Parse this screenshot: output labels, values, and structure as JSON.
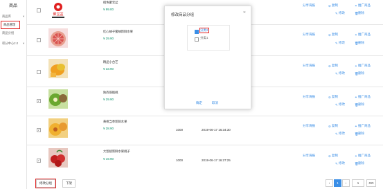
{
  "sidebar": {
    "title": "商品",
    "items": [
      {
        "label": "商品库",
        "chev": "▾"
      },
      {
        "label": "商品管理",
        "chev": ""
      },
      {
        "label": "商品分组",
        "chev": ""
      },
      {
        "label": "积分中心2.0",
        "chev": "▾"
      }
    ]
  },
  "products": [
    {
      "name": "聚宝盆",
      "subname": "橙色聚宝盆",
      "price": "¥ 99.00",
      "stock": "",
      "time": "",
      "checked": false,
      "thumb": "logo"
    },
    {
      "name": "红心柚子蜜柚新鲜水果",
      "price": "¥ 29.90",
      "stock": "",
      "time": "",
      "checked": false,
      "thumb": "grapefruit"
    },
    {
      "name": "精品小台芒",
      "price": "¥ 33.90",
      "stock": "",
      "time": "",
      "checked": false,
      "thumb": "mango"
    },
    {
      "name": "陕西猕猴桃",
      "price": "¥ 29.90",
      "stock": "",
      "time": "",
      "checked": true,
      "thumb": "kiwi"
    },
    {
      "name": "黄桃当季新鲜水果",
      "price": "¥ 28.90",
      "stock": "1000",
      "time": "2019-06-17 16:34:30",
      "checked": true,
      "thumb": "peach"
    },
    {
      "name": "大梨桃新鲜水果桃子",
      "price": "¥ 19.90",
      "stock": "1000",
      "time": "2019-06-17 16:27:25",
      "checked": true,
      "thumb": "cherry"
    }
  ],
  "actions": {
    "share": "分享海报",
    "copy": "复制",
    "promote": "推广商品",
    "edit": "修改",
    "delete": "删除"
  },
  "modal": {
    "title": "修改商品分组",
    "close": "×",
    "groups": [
      {
        "label": "分类2",
        "checked": true
      },
      {
        "label": "分类1",
        "checked": false
      }
    ],
    "ok": "确定",
    "cancel": "取消"
  },
  "footer": {
    "modify_group": "修改分组",
    "offshelf": "下架",
    "prev": "‹",
    "page": "1",
    "next": "›",
    "jump_value": "1",
    "go": "GO"
  },
  "colors": {
    "accent": "#3a8ee6",
    "price": "#0b8f6a",
    "highlight": "#e02020"
  }
}
